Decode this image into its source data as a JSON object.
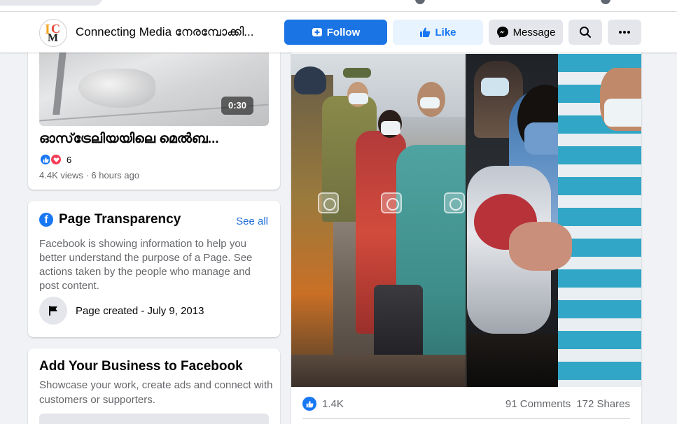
{
  "header": {
    "page_name": "Connecting Media നേരമ്പോക്കി...",
    "follow_label": "Follow",
    "like_label": "Like",
    "message_label": "Message"
  },
  "video_card": {
    "duration": "0:30",
    "title": "ഓസ്‌ട്രേലിയയിലെ മെൽബ...",
    "reaction_count": "6",
    "meta": "4.4K views · 6 hours ago"
  },
  "transparency": {
    "title": "Page Transparency",
    "see_all": "See all",
    "description": "Facebook is showing information to help you better understand the purpose of a Page. See actions taken by the people who manage and post content.",
    "created": "Page created - July 9, 2013"
  },
  "business": {
    "title": "Add Your Business to Facebook",
    "description": "Showcase your work, create ads and connect with customers or supporters."
  },
  "post": {
    "like_count": "1.4K",
    "comments": "91 Comments",
    "shares": "172 Shares"
  },
  "colors": {
    "primary_blue": "#1b74e4",
    "link_blue": "#216fdb",
    "light_blue_bg": "#e7f3ff",
    "gray_button": "#e4e6eb",
    "page_bg": "#f0f2f5"
  }
}
